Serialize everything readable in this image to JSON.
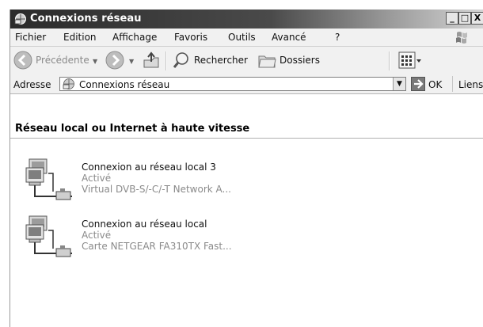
{
  "window": {
    "title": "Connexions réseau",
    "buttons": {
      "minimize": "_",
      "maximize": "□",
      "close": "X"
    }
  },
  "menu": {
    "items": [
      "Fichier",
      "Edition",
      "Affichage",
      "Favoris",
      "Outils",
      "Avancé",
      "?"
    ]
  },
  "toolbar": {
    "back_label": "Précédente",
    "search_label": "Rechercher",
    "folders_label": "Dossiers",
    "icons": [
      "back-arrow-icon",
      "forward-arrow-icon",
      "up-folder-icon",
      "search-icon",
      "folders-icon",
      "views-icon"
    ]
  },
  "address": {
    "label": "Adresse",
    "value": "Connexions réseau",
    "go_label": "OK",
    "links_label": "Liens"
  },
  "content": {
    "group_header": "Réseau local ou Internet à haute vitesse",
    "connections": [
      {
        "name": "Connexion au réseau local 3",
        "status": "Activé",
        "device": "Virtual DVB-S/-C/-T Network A..."
      },
      {
        "name": "Connexion au réseau local",
        "status": "Activé",
        "device": "Carte NETGEAR FA310TX Fast..."
      }
    ]
  },
  "colors": {
    "title_bar_start": "#2b2b2b",
    "title_bar_end": "#d4d4d4",
    "chrome": "#f1f1f1",
    "secondary_text": "#8a8a8a"
  }
}
